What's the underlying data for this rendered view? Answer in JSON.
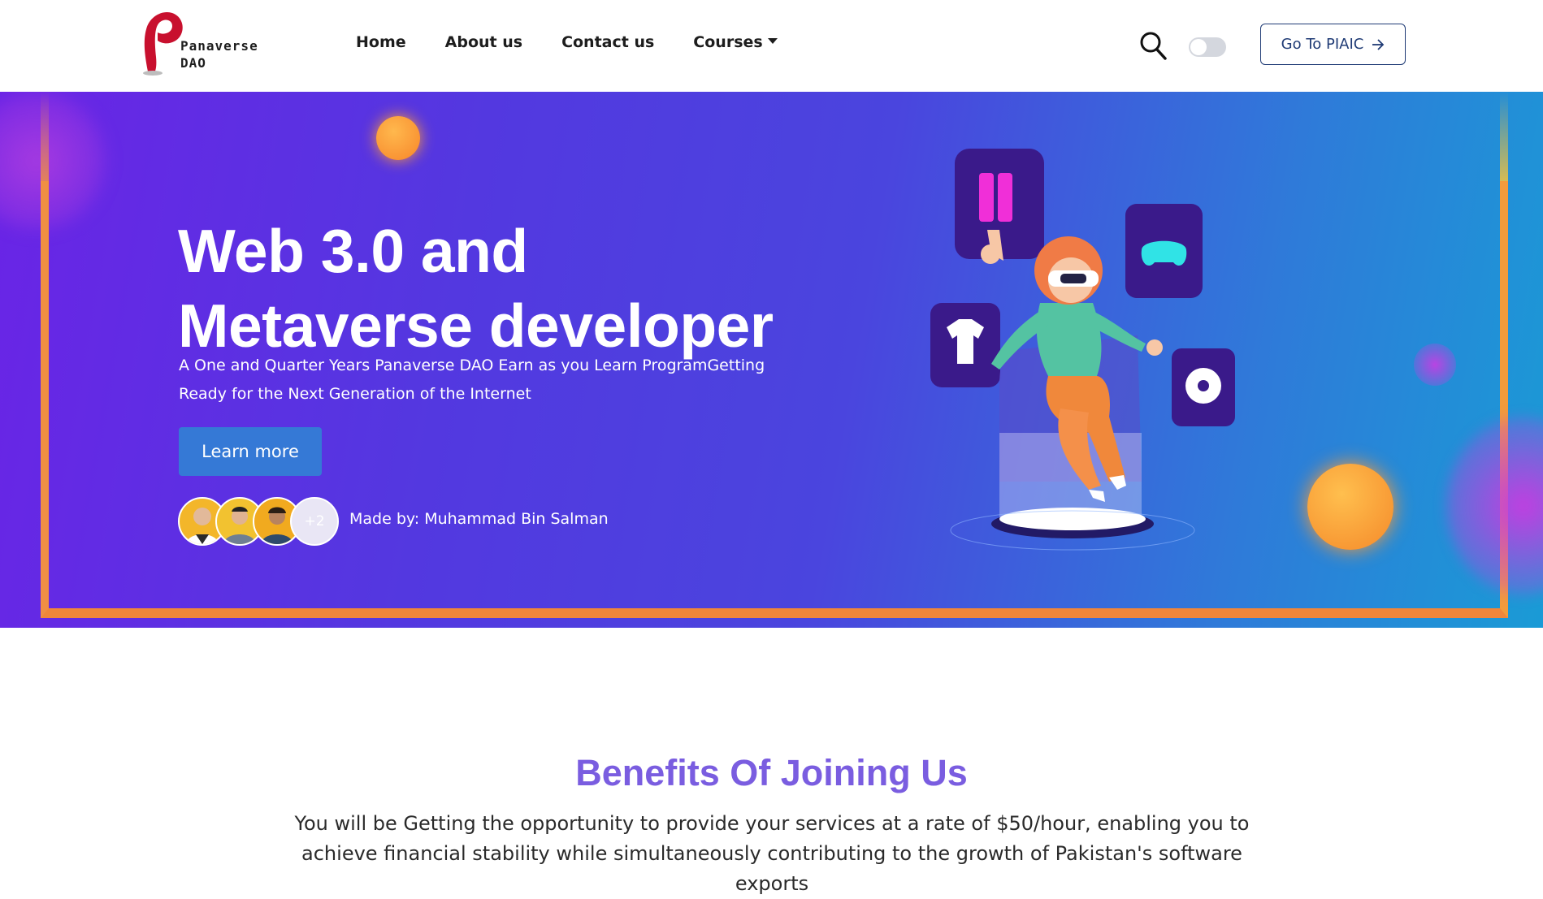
{
  "navbar": {
    "logo_line1": "Panaverse",
    "logo_line2": "DAO",
    "links": [
      {
        "label": "Home"
      },
      {
        "label": "About us"
      },
      {
        "label": "Contact us"
      },
      {
        "label": "Courses"
      }
    ],
    "search_icon": "search-icon",
    "theme_toggle_state": "off",
    "cta_label": "Go To PIAIC",
    "cta_icon": "arrow-right-icon"
  },
  "hero": {
    "title_line1": "Web 3.0 and",
    "title_line2": "Metaverse developer",
    "subtitle": "A One and Quarter Years Panaverse DAO Earn as you Learn ProgramGetting Ready for the Next Generation of the Internet",
    "button_label": "Learn more",
    "avatar_more_label": "+2",
    "made_by": "Made by: Muhammad Bin Salman",
    "colors": {
      "gradient_start": "#6a24e6",
      "gradient_end": "#1a9bd6",
      "frame": "#f08f43",
      "button": "#3579d6"
    }
  },
  "benefits": {
    "title": "Benefits Of Joining Us",
    "text": "You will be Getting the opportunity to provide your services at a rate of $50/hour, enabling you to achieve financial stability while simultaneously contributing to the growth of Pakistan's software exports",
    "title_color": "#7a5de0"
  }
}
